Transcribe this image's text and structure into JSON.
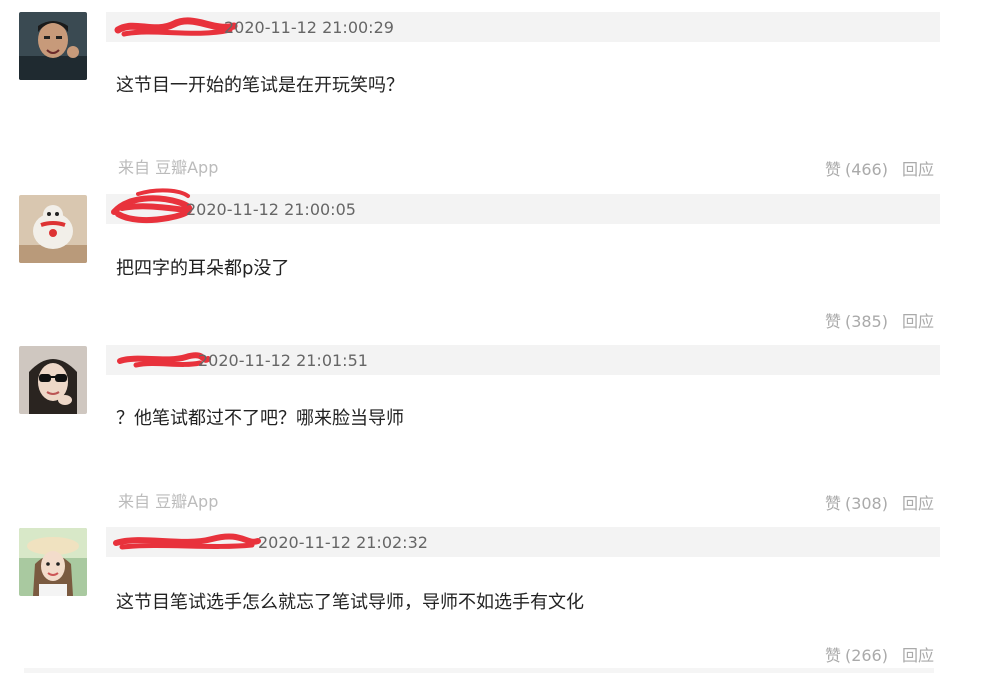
{
  "comments": [
    {
      "timestamp": "2020-11-12 21:00:29",
      "text": "这节目一开始的笔试是在开玩笑吗？",
      "source": "来自 豆瓣App",
      "like_label": "赞",
      "like_count": "(466)",
      "reply_label": "回应"
    },
    {
      "timestamp": "2020-11-12 21:00:05",
      "text": "把四字的耳朵都p没了",
      "source": "",
      "like_label": "赞",
      "like_count": "(385)",
      "reply_label": "回应"
    },
    {
      "timestamp": "2020-11-12 21:01:51",
      "text": "？他笔试都过不了吧？哪来脸当导师",
      "source": "来自 豆瓣App",
      "like_label": "赞",
      "like_count": "(308)",
      "reply_label": "回应"
    },
    {
      "timestamp": "2020-11-12 21:02:32",
      "text": "这节目笔试选手怎么就忘了笔试导师，导师不如选手有文化",
      "source": "",
      "like_label": "赞",
      "like_count": "(266)",
      "reply_label": "回应"
    }
  ],
  "colors": {
    "header_bar": "#f3f3f3",
    "redaction": "#e8323c",
    "muted_text": "#aaaaaa",
    "body_text": "#222222"
  }
}
